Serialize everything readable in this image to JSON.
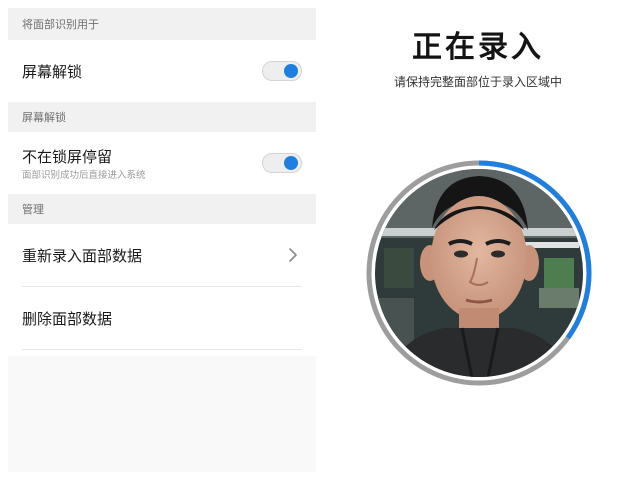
{
  "settings": {
    "section_use_for": "将面部识别用于",
    "screen_unlock_label": "屏幕解锁",
    "screen_unlock_enabled": true,
    "section_screen_unlock": "屏幕解锁",
    "stay_off_lock_label": "不在锁屏停留",
    "stay_off_lock_sub": "面部识别成功后直接进入系统",
    "stay_off_lock_enabled": true,
    "section_manage": "管理",
    "reenroll_label": "重新录入面部数据",
    "delete_label": "删除面部数据"
  },
  "enroll": {
    "title": "正在录入",
    "hint": "请保持完整面部位于录入区域中",
    "progress": 0.35
  },
  "colors": {
    "accent": "#1e7fe0",
    "section_bg": "#f1f1f1"
  },
  "icons": {
    "chevron": "chevron-right-icon"
  }
}
